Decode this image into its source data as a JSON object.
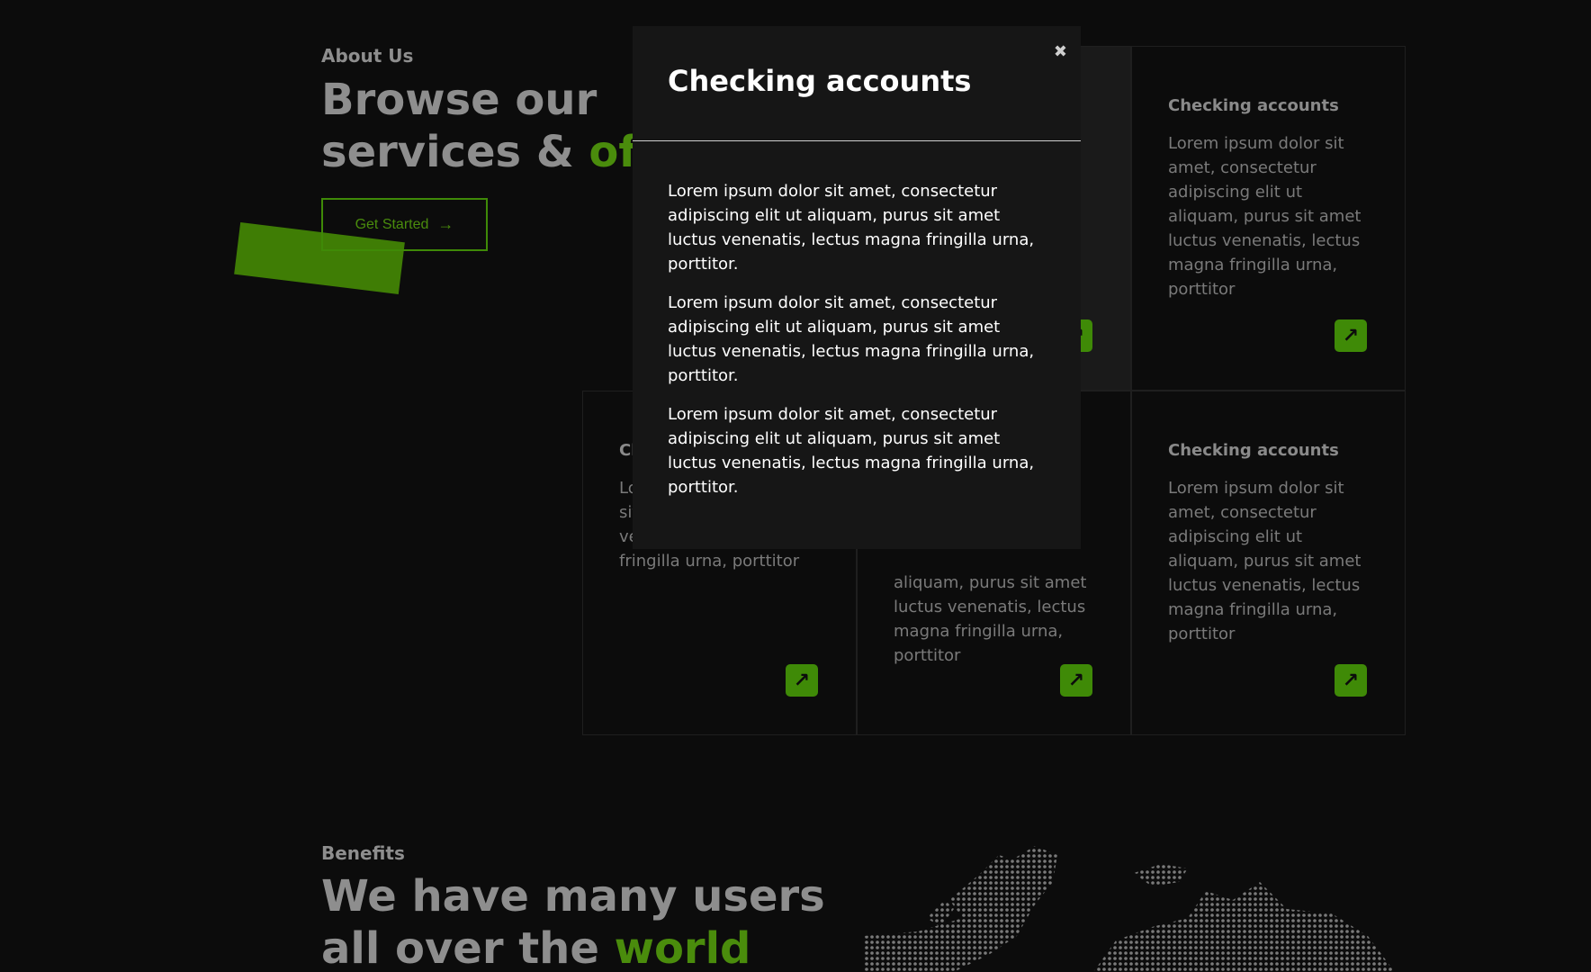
{
  "about": {
    "kicker": "About Us",
    "heading_line1": "Browse our",
    "heading_line2_plain": "services & ",
    "heading_line2_accent": "offe",
    "cta_label": "Get Started",
    "cta_icon": "→"
  },
  "cards": [
    {
      "title": "",
      "text": "",
      "arrow": "↗"
    },
    {
      "title": "Checking accounts",
      "text": "Lorem ipsum dolor sit amet, consectetur adipiscing elit ut aliquam, purus sit amet luctus venenatis, lectus magna fringilla urna, porttitor",
      "arrow": "↗"
    },
    {
      "title": "Cl",
      "text": "Lo ar ac aliquam, purus sit amet luctus venenatis, lectus magna fringilla urna, porttitor",
      "arrow": "↗"
    },
    {
      "title": "",
      "text": "aliquam, purus sit amet luctus venenatis, lectus magna fringilla urna, porttitor",
      "arrow": "↗"
    },
    {
      "title": "Checking accounts",
      "text": "Lorem ipsum dolor sit amet, consectetur adipiscing elit ut aliquam, purus sit amet luctus venenatis, lectus magna fringilla urna, porttitor",
      "arrow": "↗"
    }
  ],
  "modal": {
    "title": "Checking accounts",
    "close": "✖",
    "paragraphs": [
      "Lorem ipsum dolor sit amet, consectetur adipiscing elit ut aliquam, purus sit amet luctus venenatis, lectus magna fringilla urna, porttitor.",
      "Lorem ipsum dolor sit amet, consectetur adipiscing elit ut aliquam, purus sit amet luctus venenatis, lectus magna fringilla urna, porttitor.",
      "Lorem ipsum dolor sit amet, consectetur adipiscing elit ut aliquam, purus sit amet luctus venenatis, lectus magna fringilla urna, porttitor."
    ]
  },
  "benefits": {
    "kicker": "Benefits",
    "heading_line1": "We have many users",
    "heading_line2_plain": "all over the ",
    "heading_line2_accent": "world"
  },
  "colors": {
    "accent": "#4a8c0c",
    "background": "#0c0c0c",
    "modal": "#161616"
  }
}
